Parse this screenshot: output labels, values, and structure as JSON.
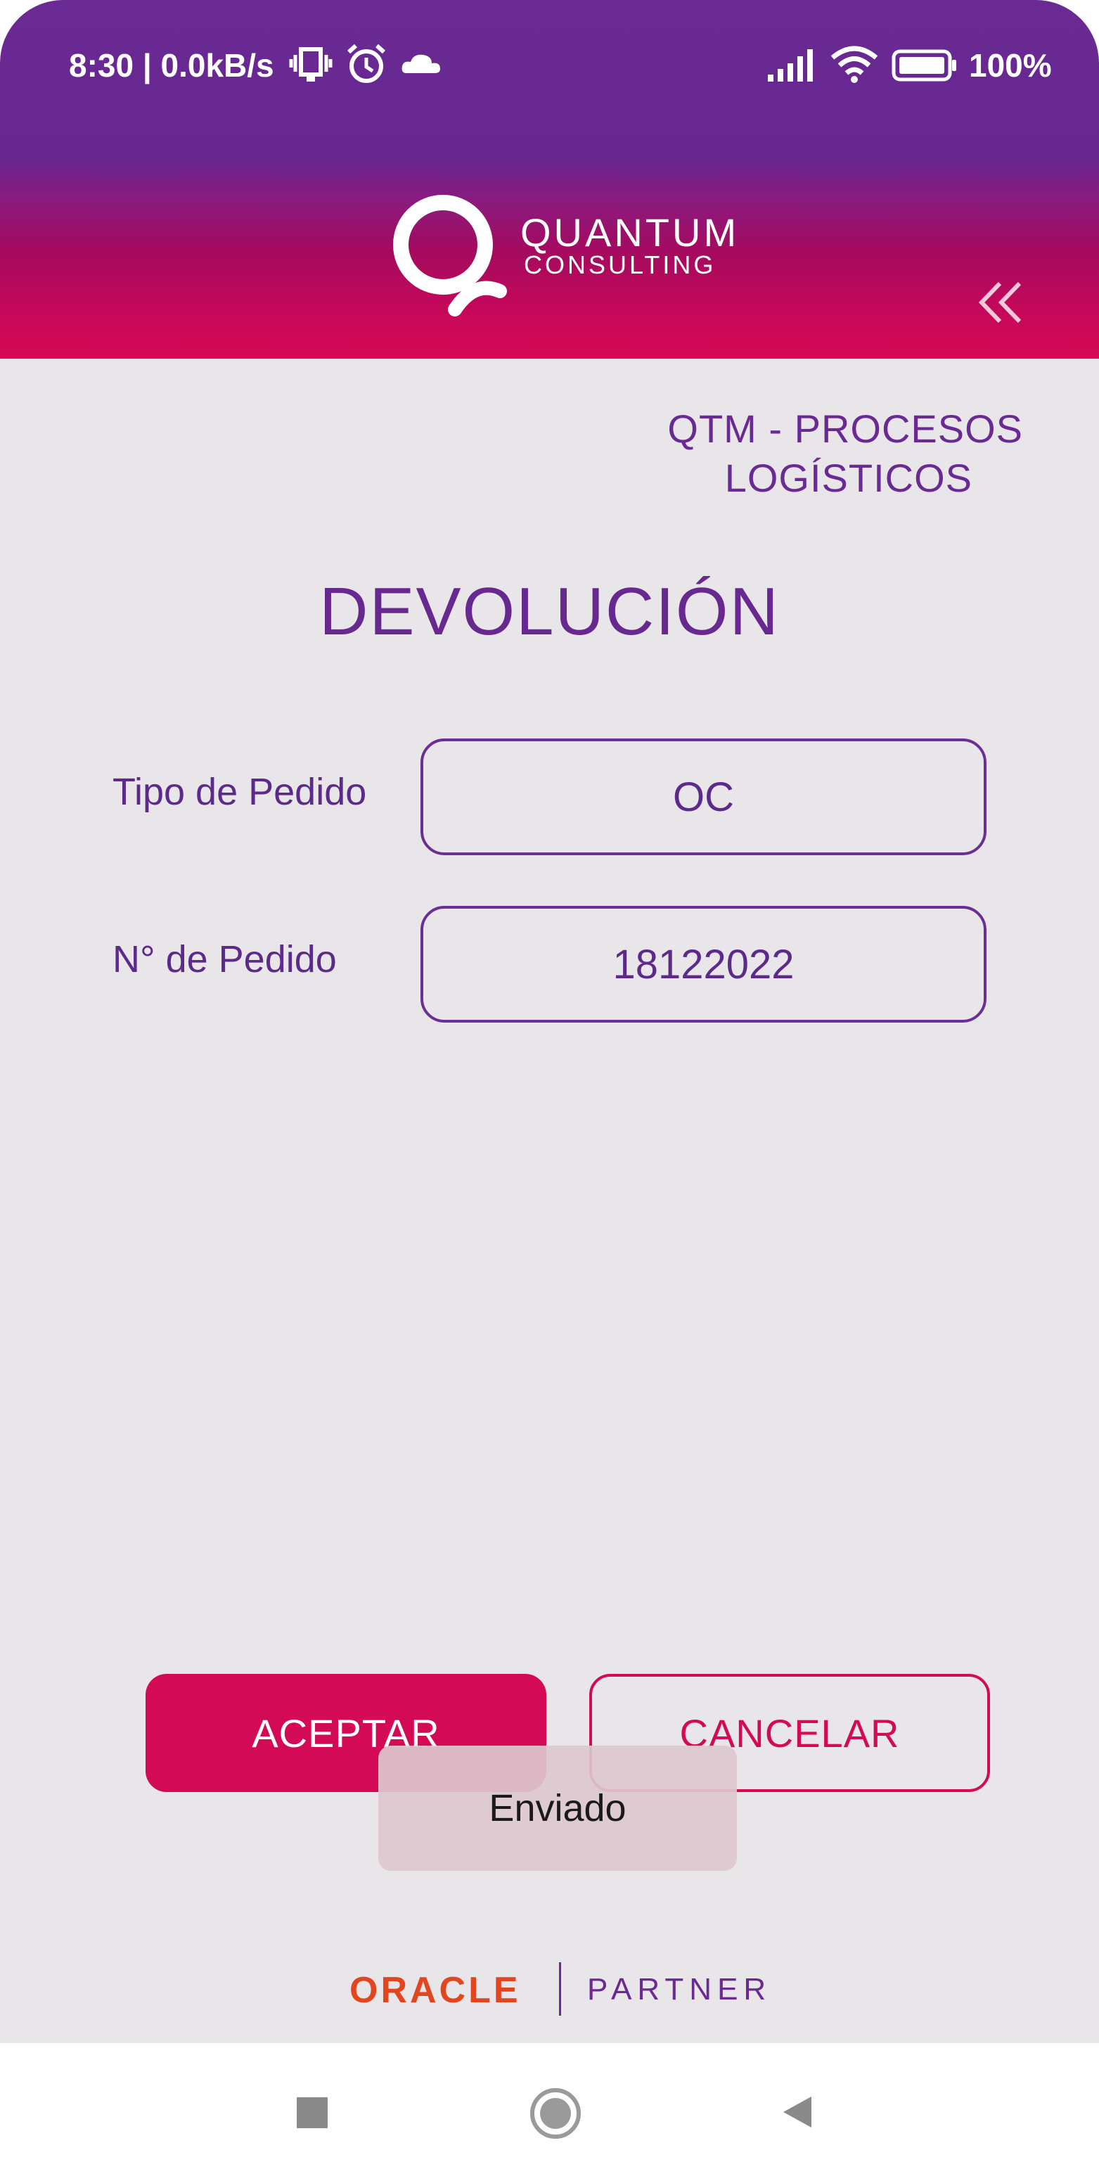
{
  "status_bar": {
    "left_text": "8:30 | 0.0kB/s",
    "battery_text": "100%",
    "icons": [
      "vibrate-icon",
      "alarm-icon",
      "cloud-icon",
      "signal-icon",
      "wifi-icon",
      "battery-icon"
    ]
  },
  "header": {
    "brand_line1": "QUANTUM",
    "brand_line2": "CONSULTING",
    "collapse_icon": "double-chevron-left-icon"
  },
  "module": {
    "title_line1": "QTM - PROCESOS",
    "title_line2": "LOGÍSTICOS"
  },
  "page": {
    "title": "DEVOLUCIÓN"
  },
  "form": {
    "order_type_label": "Tipo de Pedido",
    "order_type_value": "OC",
    "order_number_label": "N° de Pedido",
    "order_number_value": "18122022"
  },
  "actions": {
    "accept_label": "ACEPTAR",
    "cancel_label": "CANCELAR"
  },
  "toast": {
    "message": "Enviado"
  },
  "footer": {
    "oracle": "ORACLE",
    "partner": "PARTNER"
  },
  "colors": {
    "brand_purple": "#6a2a93",
    "brand_pink": "#d30a55",
    "background": "#e8e6e9",
    "oracle_red": "#e2461f"
  },
  "nav": {
    "icons": [
      "recents-square-icon",
      "home-circle-icon",
      "back-triangle-icon"
    ]
  }
}
